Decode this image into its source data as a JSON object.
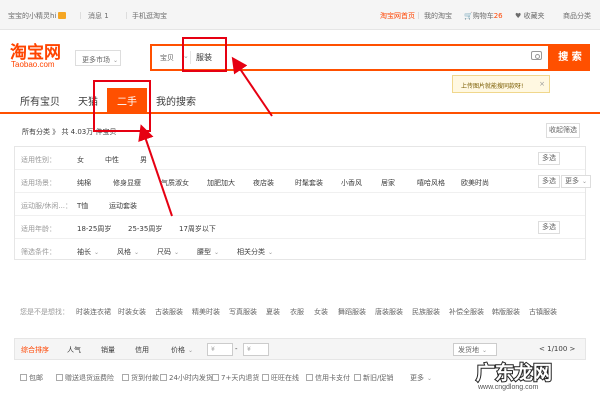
{
  "topbar": {
    "location": "宝宝的小精灵hi",
    "messages": "消息 1",
    "mobile": "手机逛淘宝",
    "home": "淘宝网首页",
    "my_taobao": "我的淘宝",
    "cart": "购物车",
    "cart_count": "26",
    "favorites": "收藏夹",
    "categories": "商品分类"
  },
  "logo": {
    "cn": "淘宝网",
    "en": "Taobao.com"
  },
  "market": {
    "label": "更多市场"
  },
  "search": {
    "category": "宝贝",
    "value": "服装",
    "button": "搜 索"
  },
  "tip": {
    "text": "上传图片就能搜同款呀!",
    "close": "×"
  },
  "tabs": [
    {
      "label": "所有宝贝"
    },
    {
      "label": "天猫"
    },
    {
      "label": "二手"
    },
    {
      "label": "我的搜索"
    }
  ],
  "breadcrumb": {
    "text": "所有分类 》 共 4.03万 件宝贝"
  },
  "collapse": {
    "label": "收起筛选"
  },
  "filters": [
    {
      "label": "适用性别：",
      "options": [
        "女",
        "中性",
        "男"
      ],
      "buttons": [
        "多选"
      ]
    },
    {
      "label": "适用场景：",
      "options": [
        "纯棉",
        "修身显瘦",
        "气质淑女",
        "加肥加大",
        "夜店装",
        "时髦套装",
        "小香风",
        "居家",
        "嘻哈风格",
        "欧美时尚"
      ],
      "buttons": [
        "多选",
        "更多"
      ]
    },
    {
      "label": "运动服/休闲...：",
      "options": [
        "T恤",
        "运动套装"
      ],
      "buttons": []
    },
    {
      "label": "适用年龄：",
      "options": [
        "18-25周岁",
        "25-35周岁",
        "17周岁以下"
      ],
      "buttons": [
        "多选"
      ]
    },
    {
      "label": "筛选条件：",
      "options": [
        "袖长",
        "风格",
        "尺码",
        "腰型",
        "相关分类"
      ],
      "buttons": []
    }
  ],
  "guess": {
    "label": "您是不是想找：",
    "items": [
      "时装连衣裙",
      "时装女装",
      "古装服装",
      "精美时装",
      "写真服装",
      "夏装",
      "衣服",
      "女装",
      "舞蹈服装",
      "唐装服装",
      "民族服装",
      "补偿全服装",
      "韩版服装",
      "古镇服装"
    ]
  },
  "sort": {
    "items": [
      "综合排序",
      "人气",
      "销量",
      "信用",
      "价格"
    ],
    "price_min": "¥",
    "price_max": "¥",
    "shipping": "发货地",
    "pager": "1/100",
    "prev": "<",
    "next": ">"
  },
  "services": {
    "items": [
      "包邮",
      "赠送退货运费险",
      "货到付款",
      "24小时内发货",
      "7+天内退货",
      "旺旺在线",
      "信用卡支付",
      "新旧/促销"
    ],
    "more": "更多"
  },
  "watermark": {
    "text": "广东龙网",
    "url": "www.cngdlong.com"
  },
  "colors": {
    "accent": "#ff5000",
    "annotation": "#e60012",
    "tip_bg": "#fff8e1"
  }
}
